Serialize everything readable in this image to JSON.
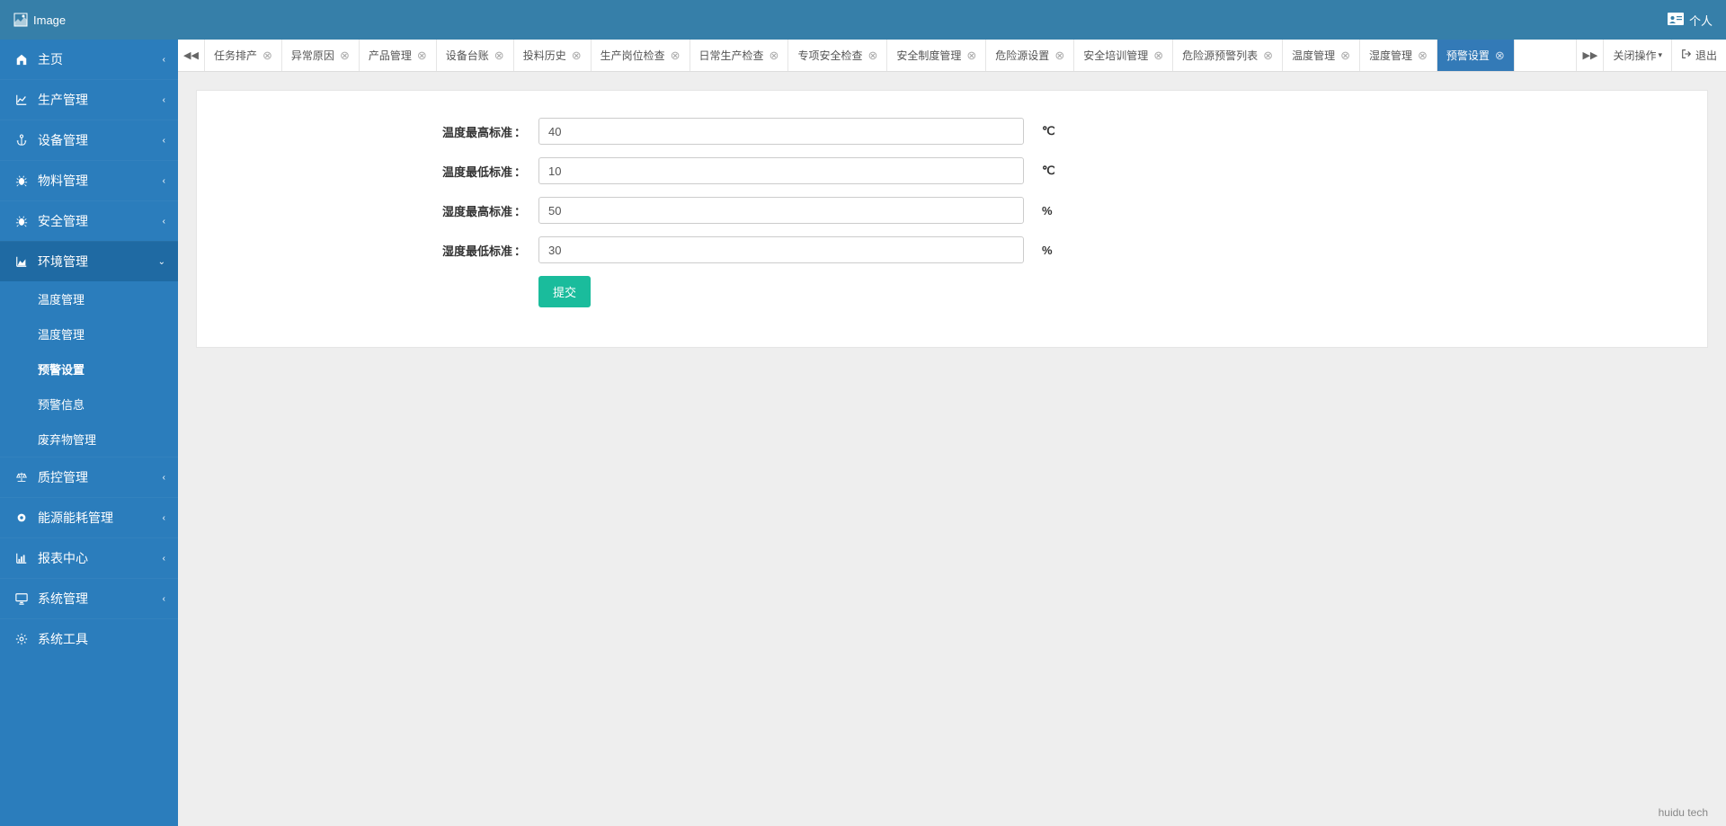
{
  "header": {
    "logo_alt": "Image",
    "user_label": "个人"
  },
  "sidebar": {
    "items": [
      {
        "icon": "home-icon",
        "label": "主页",
        "chevron": true
      },
      {
        "icon": "chart-line-icon",
        "label": "生产管理",
        "chevron": true
      },
      {
        "icon": "anchor-icon",
        "label": "设备管理",
        "chevron": true
      },
      {
        "icon": "bug-icon",
        "label": "物料管理",
        "chevron": true
      },
      {
        "icon": "bug-icon",
        "label": "安全管理",
        "chevron": true
      },
      {
        "icon": "chart-area-icon",
        "label": "环境管理",
        "chevron": true,
        "expanded": true,
        "children": [
          {
            "label": "温度管理"
          },
          {
            "label": "温度管理"
          },
          {
            "label": "预警设置",
            "current": true
          },
          {
            "label": "预警信息"
          },
          {
            "label": "废弃物管理"
          }
        ]
      },
      {
        "icon": "scale-icon",
        "label": "质控管理",
        "chevron": true
      },
      {
        "icon": "gear-icon",
        "label": "能源能耗管理",
        "chevron": true
      },
      {
        "icon": "chart-bar-icon",
        "label": "报表中心",
        "chevron": true
      },
      {
        "icon": "monitor-icon",
        "label": "系统管理",
        "chevron": true
      },
      {
        "icon": "cog-icon",
        "label": "系统工具",
        "chevron": false
      }
    ]
  },
  "tabs": {
    "items": [
      {
        "label": "任务排产"
      },
      {
        "label": "异常原因"
      },
      {
        "label": "产品管理"
      },
      {
        "label": "设备台账"
      },
      {
        "label": "投料历史"
      },
      {
        "label": "生产岗位检查"
      },
      {
        "label": "日常生产检查"
      },
      {
        "label": "专项安全检查"
      },
      {
        "label": "安全制度管理"
      },
      {
        "label": "危险源设置"
      },
      {
        "label": "安全培训管理"
      },
      {
        "label": "危险源预警列表"
      },
      {
        "label": "温度管理"
      },
      {
        "label": "湿度管理"
      },
      {
        "label": "预警设置",
        "active": true
      }
    ],
    "close_ops_label": "关闭操作",
    "exit_label": "退出"
  },
  "form": {
    "fields": [
      {
        "label": "温度最高标准",
        "value": "40",
        "unit": "℃"
      },
      {
        "label": "温度最低标准",
        "value": "10",
        "unit": "℃"
      },
      {
        "label": "湿度最高标准",
        "value": "50",
        "unit": "%"
      },
      {
        "label": "湿度最低标准",
        "value": "30",
        "unit": "%"
      }
    ],
    "submit_label": "提交"
  },
  "footer": {
    "text": "huidu tech"
  }
}
